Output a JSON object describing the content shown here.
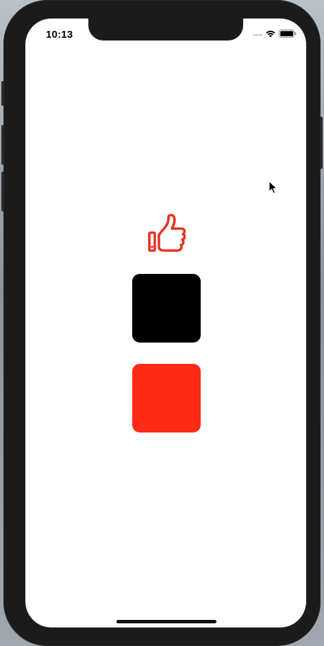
{
  "status_bar": {
    "time": "10:13",
    "icons": [
      "signal-dots-icon",
      "wifi-icon",
      "battery-icon"
    ]
  },
  "main": {
    "icon": "thumbs-up-icon",
    "icon_color": "#e53222",
    "squares": [
      {
        "name": "black-square",
        "color": "#000000"
      },
      {
        "name": "red-square",
        "color": "#ff2b17"
      }
    ]
  },
  "colors": {
    "device_frame": "#1b1b1c",
    "screen_background": "#ffffff"
  }
}
